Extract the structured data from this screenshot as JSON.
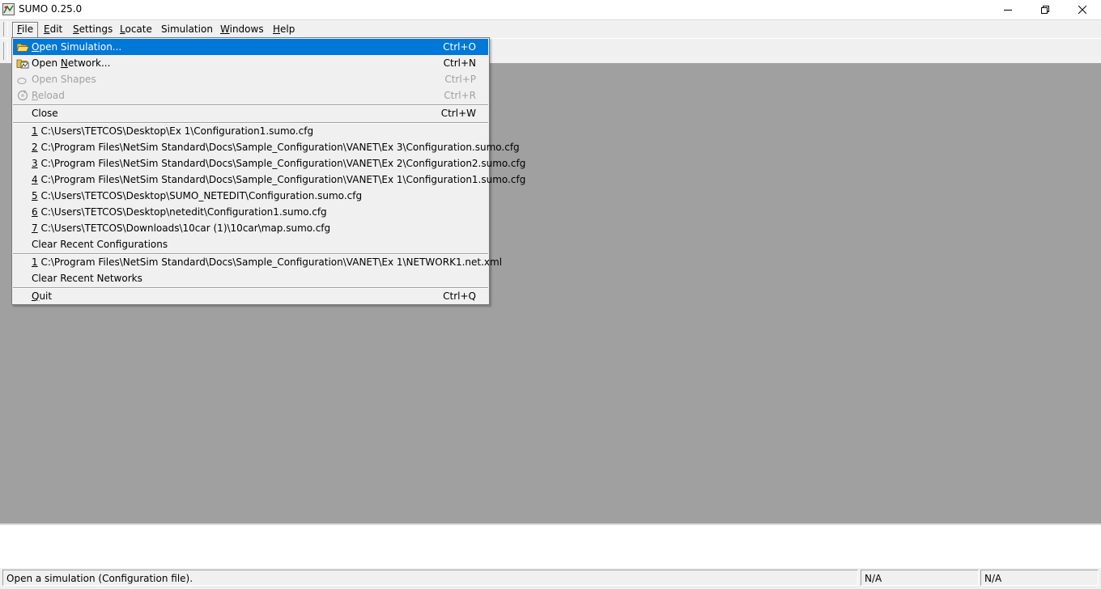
{
  "window": {
    "title": "SUMO 0.25.0",
    "icon": "sumo-app-icon",
    "controls": [
      "minimize-icon",
      "restore-icon",
      "close-icon"
    ]
  },
  "menubar": {
    "items": [
      {
        "label": "File"
      },
      {
        "label": "Edit"
      },
      {
        "label": "Settings"
      },
      {
        "label": "Locate"
      },
      {
        "label": "Simulation"
      },
      {
        "label": "Windows"
      },
      {
        "label": "Help"
      }
    ]
  },
  "file_menu": {
    "open_simulation": {
      "label": "Open Simulation...",
      "shortcut": "Ctrl+O",
      "icon": "folder-open-icon"
    },
    "open_network": {
      "label": "Open Network...",
      "shortcut": "Ctrl+N",
      "icon": "network-open-icon"
    },
    "open_shapes": {
      "label": "Open Shapes",
      "shortcut": "Ctrl+P",
      "icon": "shapes-icon"
    },
    "reload": {
      "label": "Reload",
      "shortcut": "Ctrl+R",
      "icon": "reload-icon"
    },
    "close": {
      "label": "Close",
      "shortcut": "Ctrl+W"
    },
    "recent_configurations": [
      {
        "num": "1",
        "path": " C:\\Users\\TETCOS\\Desktop\\Ex 1\\Configuration1.sumo.cfg"
      },
      {
        "num": "2",
        "path": " C:\\Program Files\\NetSim Standard\\Docs\\Sample_Configuration\\VANET\\Ex 3\\Configuration.sumo.cfg"
      },
      {
        "num": "3",
        "path": " C:\\Program Files\\NetSim Standard\\Docs\\Sample_Configuration\\VANET\\Ex 2\\Configuration2.sumo.cfg"
      },
      {
        "num": "4",
        "path": " C:\\Program Files\\NetSim Standard\\Docs\\Sample_Configuration\\VANET\\Ex 1\\Configuration1.sumo.cfg"
      },
      {
        "num": "5",
        "path": " C:\\Users\\TETCOS\\Desktop\\SUMO_NETEDIT\\Configuration.sumo.cfg"
      },
      {
        "num": "6",
        "path": " C:\\Users\\TETCOS\\Desktop\\netedit\\Configuration1.sumo.cfg"
      },
      {
        "num": "7",
        "path": " C:\\Users\\TETCOS\\Downloads\\10car (1)\\10car\\map.sumo.cfg"
      }
    ],
    "clear_recent_configurations": "Clear Recent Configurations",
    "recent_networks": [
      {
        "num": "1",
        "path": " C:\\Program Files\\NetSim Standard\\Docs\\Sample_Configuration\\VANET\\Ex 1\\NETWORK1.net.xml"
      }
    ],
    "clear_recent_networks": "Clear Recent Networks",
    "quit": {
      "label": "Quit",
      "shortcut": "Ctrl+Q"
    }
  },
  "statusbar": {
    "message": "Open a simulation (Configuration file).",
    "cell1": "N/A",
    "cell2": "N/A"
  }
}
